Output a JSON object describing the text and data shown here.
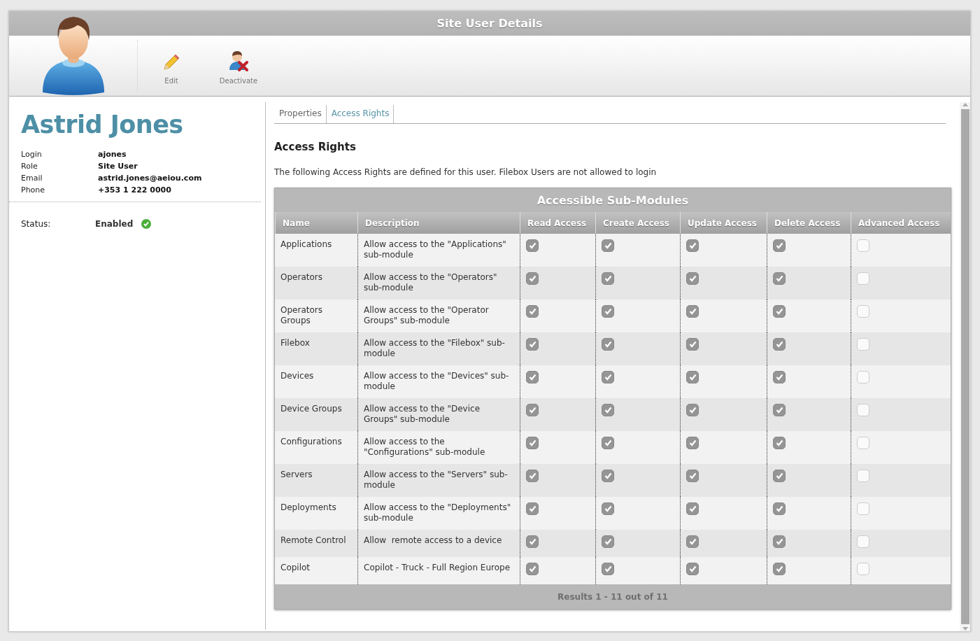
{
  "window": {
    "title": "Site User Details"
  },
  "toolbar": [
    {
      "kind": "edit",
      "label": "Edit"
    },
    {
      "kind": "deactivate",
      "label": "Deactivate"
    }
  ],
  "user": {
    "name": "Astrid Jones",
    "fields": [
      {
        "label": "Login",
        "value": "ajones"
      },
      {
        "label": "Role",
        "value": "Site User"
      },
      {
        "label": "Email",
        "value": "astrid.jones@aeiou.com"
      },
      {
        "label": "Phone",
        "value": "+353 1 222 0000"
      }
    ],
    "status": {
      "label": "Status:",
      "value": "Enabled",
      "ok": true
    }
  },
  "tabs": [
    {
      "label": "Properties",
      "selected": false
    },
    {
      "label": "Access Rights",
      "selected": true
    }
  ],
  "section": {
    "title": "Access Rights",
    "description": "The following Access Rights are defined for this user. Filebox Users are not allowed to login"
  },
  "table": {
    "title": "Accessible Sub-Modules",
    "columns": [
      "Name",
      "Description",
      "Read Access",
      "Create Access",
      "Update Access",
      "Delete Access",
      "Advanced Access"
    ],
    "rows": [
      {
        "name": "Applications",
        "description": "Allow access to the \"Applications\" sub-module",
        "access": [
          true,
          true,
          true,
          true,
          false
        ]
      },
      {
        "name": "Operators",
        "description": "Allow access to the \"Operators\" sub-module",
        "access": [
          true,
          true,
          true,
          true,
          false
        ]
      },
      {
        "name": "Operators Groups",
        "description": "Allow access to the \"Operator Groups\" sub-module",
        "access": [
          true,
          true,
          true,
          true,
          false
        ]
      },
      {
        "name": "Filebox",
        "description": "Allow access to the \"Filebox\" sub-module",
        "access": [
          true,
          true,
          true,
          true,
          false
        ]
      },
      {
        "name": "Devices",
        "description": "Allow access to the \"Devices\" sub-module",
        "access": [
          true,
          true,
          true,
          true,
          false
        ]
      },
      {
        "name": "Device Groups",
        "description": "Allow access to the \"Device Groups\" sub-module",
        "access": [
          true,
          true,
          true,
          true,
          false
        ]
      },
      {
        "name": "Configurations",
        "description": "Allow access to the \"Configurations\" sub-module",
        "access": [
          true,
          true,
          true,
          true,
          false
        ]
      },
      {
        "name": "Servers",
        "description": "Allow access to the \"Servers\" sub-module",
        "access": [
          true,
          true,
          true,
          true,
          false
        ]
      },
      {
        "name": "Deployments",
        "description": "Allow access to the \"Deployments\" sub-module",
        "access": [
          true,
          true,
          true,
          true,
          false
        ]
      },
      {
        "name": "Remote Control",
        "description": "Allow  remote access to a device",
        "access": [
          true,
          true,
          true,
          true,
          false
        ]
      },
      {
        "name": "Copilot",
        "description": "Copilot - Truck - Full Region Europe",
        "access": [
          true,
          true,
          true,
          true,
          false
        ]
      }
    ],
    "footer": "Results 1 - 11 out of 11"
  }
}
